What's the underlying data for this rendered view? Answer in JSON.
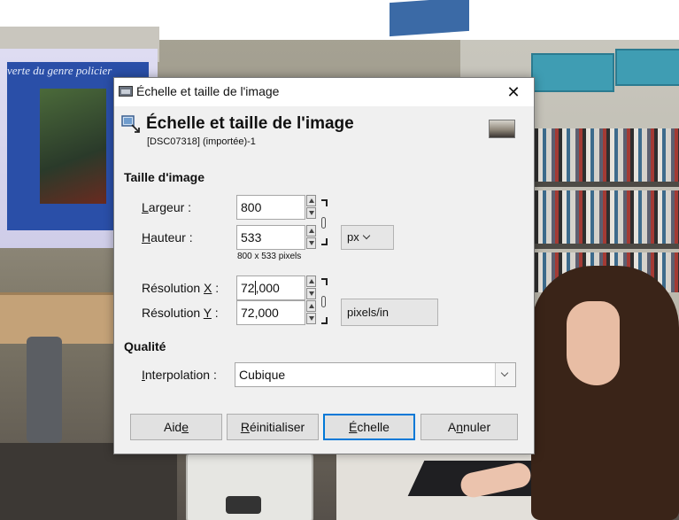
{
  "background": {
    "slide_title": "verte du genre policier"
  },
  "dialog": {
    "window_title": "Échelle et taille de l'image",
    "close_glyph": "✕",
    "header": {
      "title": "Échelle et taille de l'image",
      "subtitle": "[DSC07318] (importée)-1",
      "icon": "scale-image-icon"
    },
    "image_size": {
      "section_label": "Taille d'image",
      "width_label": [
        "",
        "L",
        "argeur :"
      ],
      "width_value": "800",
      "height_label": [
        "",
        "H",
        "auteur :"
      ],
      "height_value": "533",
      "size_unit": "px",
      "pixel_summary": "800 x 533 pixels",
      "res_x_label": [
        "Résolution ",
        "X",
        " :"
      ],
      "res_x_value_before_caret": "72",
      "res_x_value_after_caret": ",000",
      "res_y_label": [
        "Résolution ",
        "Y",
        " :"
      ],
      "res_y_value": "72,000",
      "resolution_unit": "pixels/in"
    },
    "quality": {
      "section_label": "Qualité",
      "interpolation_label": [
        "",
        "I",
        "nterpolation :"
      ],
      "interpolation_value": "Cubique"
    },
    "buttons": {
      "help": [
        "Aid",
        "e",
        ""
      ],
      "reset": [
        "",
        "R",
        "éinitialiser"
      ],
      "scale": [
        "",
        "É",
        "chelle"
      ],
      "cancel": [
        "A",
        "n",
        "nuler"
      ]
    },
    "colors": {
      "default_button_border": "#0078d7",
      "dialog_bg": "#f0f0f0"
    }
  }
}
